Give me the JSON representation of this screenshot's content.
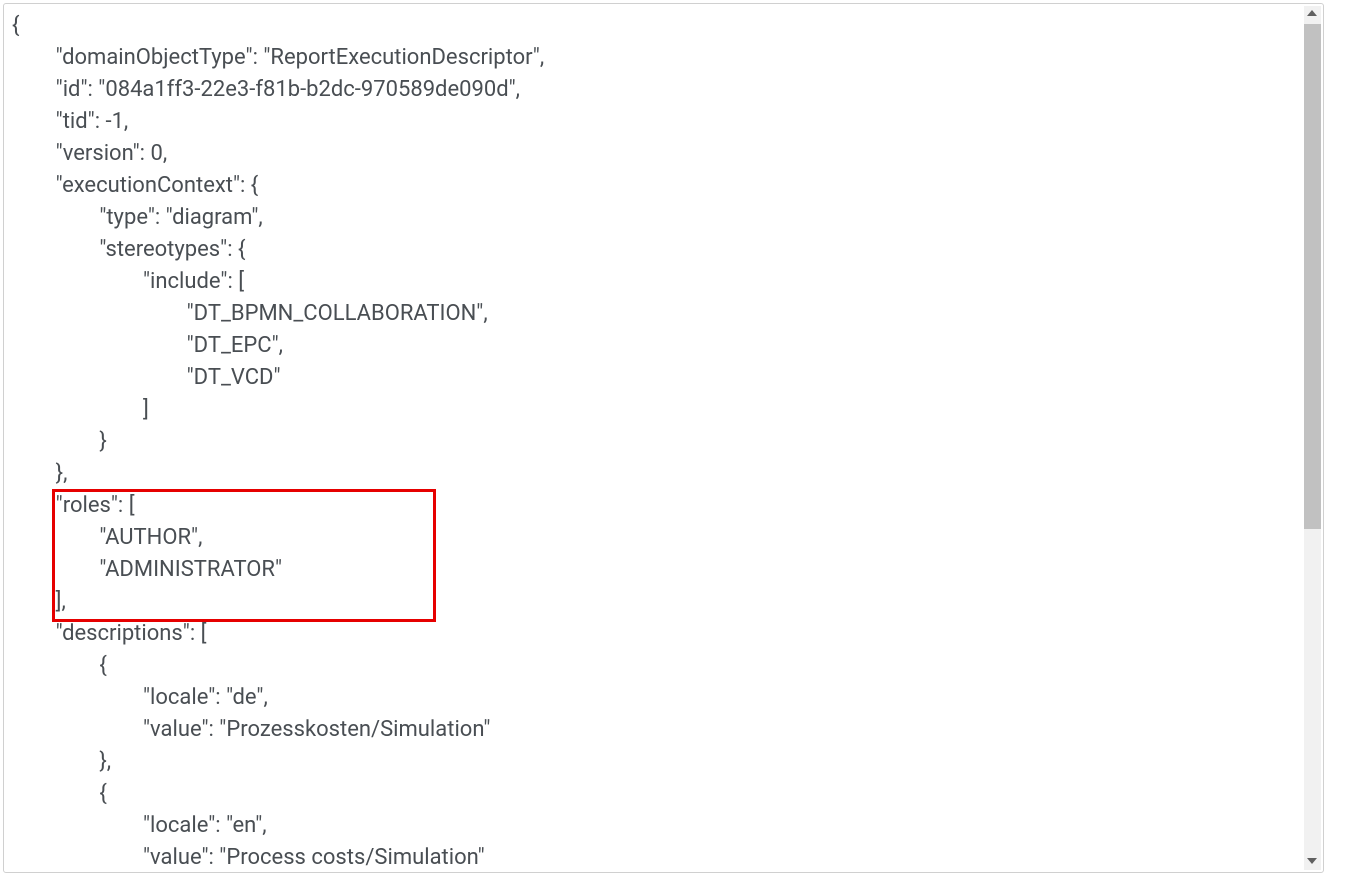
{
  "code": {
    "line1": "{",
    "line2": "        \"domainObjectType\": \"ReportExecutionDescriptor\",",
    "line3": "        \"id\": \"084a1ff3-22e3-f81b-b2dc-970589de090d\",",
    "line4": "        \"tid\": -1,",
    "line5": "        \"version\": 0,",
    "line6": "        \"executionContext\": {",
    "line7": "                \"type\": \"diagram\",",
    "line8": "                \"stereotypes\": {",
    "line9": "                        \"include\": [",
    "line10": "                                \"DT_BPMN_COLLABORATION\",",
    "line11": "                                \"DT_EPC\",",
    "line12": "                                \"DT_VCD\"",
    "line13": "                        ]",
    "line14": "                }",
    "line15": "        },",
    "line16": "        \"roles\": [",
    "line17": "                \"AUTHOR\",",
    "line18": "                \"ADMINISTRATOR\"",
    "line19": "        ],",
    "line20": "        \"descriptions\": [",
    "line21": "                {",
    "line22": "                        \"locale\": \"de\",",
    "line23": "                        \"value\": \"Prozesskosten/Simulation\"",
    "line24": "                },",
    "line25": "                {",
    "line26": "                        \"locale\": \"en\",",
    "line27": "                        \"value\": \"Process costs/Simulation\""
  },
  "highlight": {
    "present": true,
    "color": "#e60000",
    "targets_lines": [
      "roles",
      "AUTHOR",
      "ADMINISTRATOR",
      "closing_bracket"
    ]
  }
}
